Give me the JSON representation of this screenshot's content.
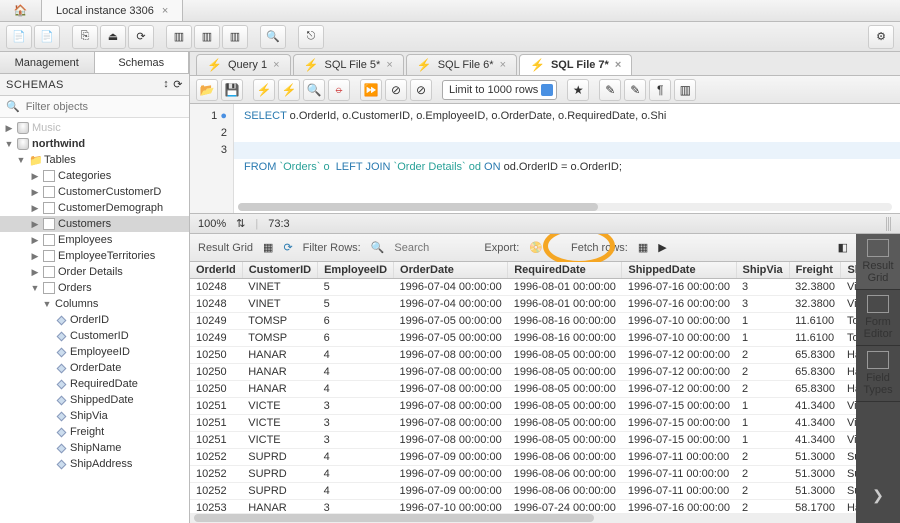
{
  "top": {
    "connection_tab": "Local instance 3306",
    "close": "×"
  },
  "sidebar": {
    "tabs": {
      "management": "Management",
      "schemas": "Schemas"
    },
    "header": "SCHEMAS",
    "filter_placeholder": "Filter objects",
    "tree": {
      "db0": "Music",
      "db1": "northwind",
      "tables_label": "Tables",
      "tables": [
        "Categories",
        "CustomerCustomerD",
        "CustomerDemograph",
        "Customers",
        "Employees",
        "EmployeeTerritories",
        "Order Details",
        "Orders"
      ],
      "columns_label": "Columns",
      "columns": [
        "OrderID",
        "CustomerID",
        "EmployeeID",
        "OrderDate",
        "RequiredDate",
        "ShippedDate",
        "ShipVia",
        "Freight",
        "ShipName",
        "ShipAddress"
      ]
    }
  },
  "query_tabs": [
    {
      "label": "Query 1",
      "active": false
    },
    {
      "label": "SQL File 5*",
      "active": false
    },
    {
      "label": "SQL File 6*",
      "active": false
    },
    {
      "label": "SQL File 7*",
      "active": true
    }
  ],
  "editor_toolbar": {
    "limit": "Limit to 1000 rows"
  },
  "code": {
    "l1a": "SELECT",
    "l1b": " o.OrderId, o.CustomerID, o.EmployeeID, o.OrderDate, o.RequiredDate, o.Shi",
    "l3a": "FROM",
    "l3b": " `Orders` o  ",
    "l3c": "LEFT JOIN",
    "l3d": " `Order Details` od ",
    "l3e": "ON",
    "l3f": " od.OrderID = o.OrderID;"
  },
  "gutter": {
    "l1": "1",
    "l2": "2",
    "l3": "3"
  },
  "status": {
    "zoom": "100%",
    "pos": "73:3"
  },
  "result_toolbar": {
    "grid_label": "Result Grid",
    "filter_label": "Filter Rows:",
    "search_placeholder": "Search",
    "export_label": "Export:",
    "fetch_label": "Fetch rows:"
  },
  "columns": [
    "OrderId",
    "CustomerID",
    "EmployeeID",
    "OrderDate",
    "RequiredDate",
    "ShippedDate",
    "ShipVia",
    "Freight",
    "Sh"
  ],
  "rows": [
    [
      "10248",
      "VINET",
      "5",
      "1996-07-04 00:00:00",
      "1996-08-01 00:00:00",
      "1996-07-16 00:00:00",
      "3",
      "32.3800",
      "Vi"
    ],
    [
      "10248",
      "VINET",
      "5",
      "1996-07-04 00:00:00",
      "1996-08-01 00:00:00",
      "1996-07-16 00:00:00",
      "3",
      "32.3800",
      "Vi"
    ],
    [
      "10249",
      "TOMSP",
      "6",
      "1996-07-05 00:00:00",
      "1996-08-16 00:00:00",
      "1996-07-10 00:00:00",
      "1",
      "11.6100",
      "To"
    ],
    [
      "10249",
      "TOMSP",
      "6",
      "1996-07-05 00:00:00",
      "1996-08-16 00:00:00",
      "1996-07-10 00:00:00",
      "1",
      "11.6100",
      "To"
    ],
    [
      "10250",
      "HANAR",
      "4",
      "1996-07-08 00:00:00",
      "1996-08-05 00:00:00",
      "1996-07-12 00:00:00",
      "2",
      "65.8300",
      "Ha"
    ],
    [
      "10250",
      "HANAR",
      "4",
      "1996-07-08 00:00:00",
      "1996-08-05 00:00:00",
      "1996-07-12 00:00:00",
      "2",
      "65.8300",
      "Ha"
    ],
    [
      "10250",
      "HANAR",
      "4",
      "1996-07-08 00:00:00",
      "1996-08-05 00:00:00",
      "1996-07-12 00:00:00",
      "2",
      "65.8300",
      "Ha"
    ],
    [
      "10251",
      "VICTE",
      "3",
      "1996-07-08 00:00:00",
      "1996-08-05 00:00:00",
      "1996-07-15 00:00:00",
      "1",
      "41.3400",
      "Vi"
    ],
    [
      "10251",
      "VICTE",
      "3",
      "1996-07-08 00:00:00",
      "1996-08-05 00:00:00",
      "1996-07-15 00:00:00",
      "1",
      "41.3400",
      "Vi"
    ],
    [
      "10251",
      "VICTE",
      "3",
      "1996-07-08 00:00:00",
      "1996-08-05 00:00:00",
      "1996-07-15 00:00:00",
      "1",
      "41.3400",
      "Vi"
    ],
    [
      "10252",
      "SUPRD",
      "4",
      "1996-07-09 00:00:00",
      "1996-08-06 00:00:00",
      "1996-07-11 00:00:00",
      "2",
      "51.3000",
      "Su"
    ],
    [
      "10252",
      "SUPRD",
      "4",
      "1996-07-09 00:00:00",
      "1996-08-06 00:00:00",
      "1996-07-11 00:00:00",
      "2",
      "51.3000",
      "Su"
    ],
    [
      "10252",
      "SUPRD",
      "4",
      "1996-07-09 00:00:00",
      "1996-08-06 00:00:00",
      "1996-07-11 00:00:00",
      "2",
      "51.3000",
      "Su"
    ],
    [
      "10253",
      "HANAR",
      "3",
      "1996-07-10 00:00:00",
      "1996-07-24 00:00:00",
      "1996-07-16 00:00:00",
      "2",
      "58.1700",
      "Ha"
    ]
  ],
  "right_panel": {
    "result_grid": "Result\nGrid",
    "form_editor": "Form\nEditor",
    "field_types": "Field\nTypes"
  }
}
